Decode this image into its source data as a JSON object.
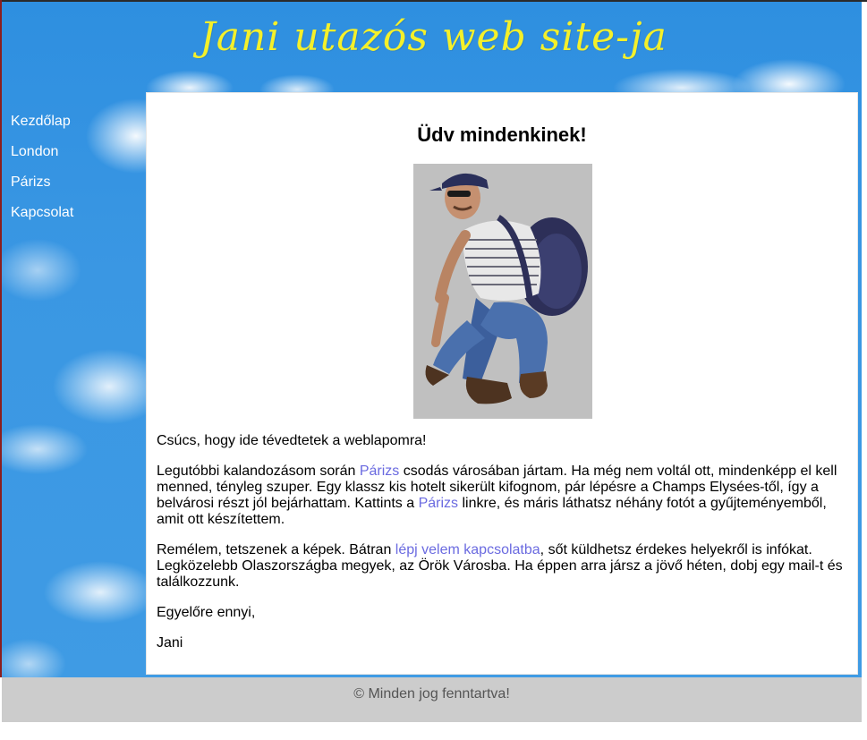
{
  "header": {
    "title": "Jani utazós web site-ja"
  },
  "nav": [
    {
      "label": "Kezdőlap"
    },
    {
      "label": "London"
    },
    {
      "label": "Párizs"
    },
    {
      "label": "Kapcsolat"
    }
  ],
  "main": {
    "heading": "Üdv mindenkinek!",
    "p1": "Csúcs, hogy ide tévedtetek a weblapomra!",
    "p2": {
      "t1": "Legutóbbi kalandozásom során ",
      "link1": "Párizs",
      "t2": " csodás városában jártam. Ha még nem voltál ott, mindenképp el kell menned, tényleg szuper. Egy klassz kis hotelt sikerült kifognom, pár lépésre a Champs Elysées-től, így a belvárosi részt jól bejárhattam. Kattints a ",
      "link2": "Párizs",
      "t3": " linkre, és máris láthatsz néhány fotót a gyűjteményemből, amit ott készítettem."
    },
    "p3": {
      "t1": "Remélem, tetszenek a képek. Bátran ",
      "link": "lépj velem kapcsolatba",
      "t2": ", sőt küldhetsz érdekes helyekről is infókat. Legközelebb Olaszországba megyek, az Örök Városba. Ha éppen arra jársz a jövő héten, dobj egy mail-t és találkozzunk."
    },
    "p4": "Egyelőre ennyi,",
    "p5": "Jani"
  },
  "footer": {
    "text": "© Minden jog fenntartva!"
  },
  "colors": {
    "sky": "#3a97e3",
    "title": "#f4f02a",
    "link": "#6a6ae0",
    "footer_bg": "#cccccc"
  }
}
